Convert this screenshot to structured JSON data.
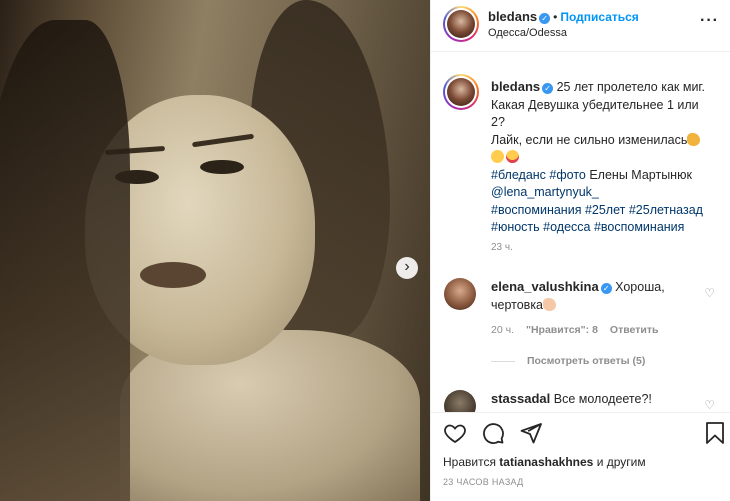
{
  "header": {
    "username": "bledans",
    "follow_label": "Подписаться",
    "location": "Одесса/Odessa"
  },
  "caption": {
    "username": "bledans",
    "line1": "25 лет пролетело как миг.",
    "line2": "Какая Девушка убедительнее 1 или",
    "line3": "2?",
    "line4": "Лайк, если не сильно изменилась",
    "tags": [
      "#бледанс",
      "#фото",
      "@lena_martynyuk_",
      "#воспоминания",
      "#25лет",
      "#25летназад",
      "#юность",
      "#одесса",
      "#воспоминания"
    ],
    "photo_text": "Елены Мартынюк",
    "time": "23 ч."
  },
  "comments": [
    {
      "username": "elena_valushkina",
      "text": "Хороша,",
      "text2": "чертовка",
      "time": "20 ч.",
      "likes": "\"Нравится\": 8",
      "reply": "Ответить",
      "view_replies": "Посмотреть ответы (5)"
    },
    {
      "username": "stassadal",
      "text": "Все молодеете?!"
    }
  ],
  "actions": {
    "liked_by_prefix": "Нравится",
    "liked_by_user": "tatianashakhnes",
    "liked_by_suffix": "и другим",
    "post_time": "23 ЧАСОВ НАЗАД"
  },
  "colors": {
    "accent": "#0095f6",
    "verified": "#3897f0",
    "hashtag": "#00376b",
    "muted": "#8e8e8e"
  },
  "icons": [
    "heart-icon",
    "comment-icon",
    "share-icon",
    "bookmark-icon",
    "more-icon",
    "verified-icon",
    "chevron-right-icon"
  ]
}
